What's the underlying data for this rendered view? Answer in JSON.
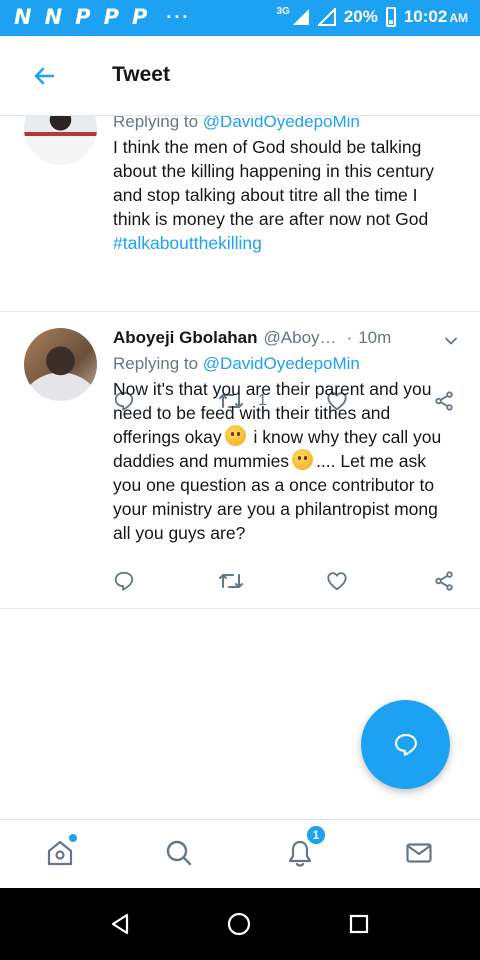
{
  "status_bar": {
    "app_icons": [
      "N",
      "N",
      "P",
      "P",
      "P"
    ],
    "more": "···",
    "network": "3G",
    "battery": "20%",
    "time": "10:02",
    "ampm": "AM"
  },
  "header": {
    "title": "Tweet",
    "back_icon": "arrow-left-icon"
  },
  "tweets": [
    {
      "reply_prefix": "Replying to ",
      "reply_handle": "@DavidOyedepoMin",
      "text": "I think the men of God should be talking about the killing happening in this century and stop talking about titre all the time I think is money the are after now not God ",
      "hashtag": "#talkaboutthekilling",
      "retweet_count": "1"
    },
    {
      "author": "Aboyeji Gbolahan",
      "handle": "@Aboy…",
      "separator": "·",
      "time": "10m",
      "reply_prefix": "Replying to ",
      "reply_handle": "@DavidOyedepoMin",
      "text_part1": "Now it's that you are their parent and you need to be feed with their tithes and offerings okay",
      "text_part2": " i know why they call you daddies and mummies",
      "text_part3": ".... Let me ask you one question as a once contributor to your ministry are you a philantropist mong all you guys are?"
    }
  ],
  "bottom_nav": {
    "items": [
      "home-icon",
      "search-icon",
      "notifications-icon",
      "messages-icon"
    ],
    "notifications_badge": "1"
  },
  "colors": {
    "accent": "#1da1f2",
    "text": "#14171a",
    "muted": "#657786",
    "divider": "#e1e8ed"
  }
}
